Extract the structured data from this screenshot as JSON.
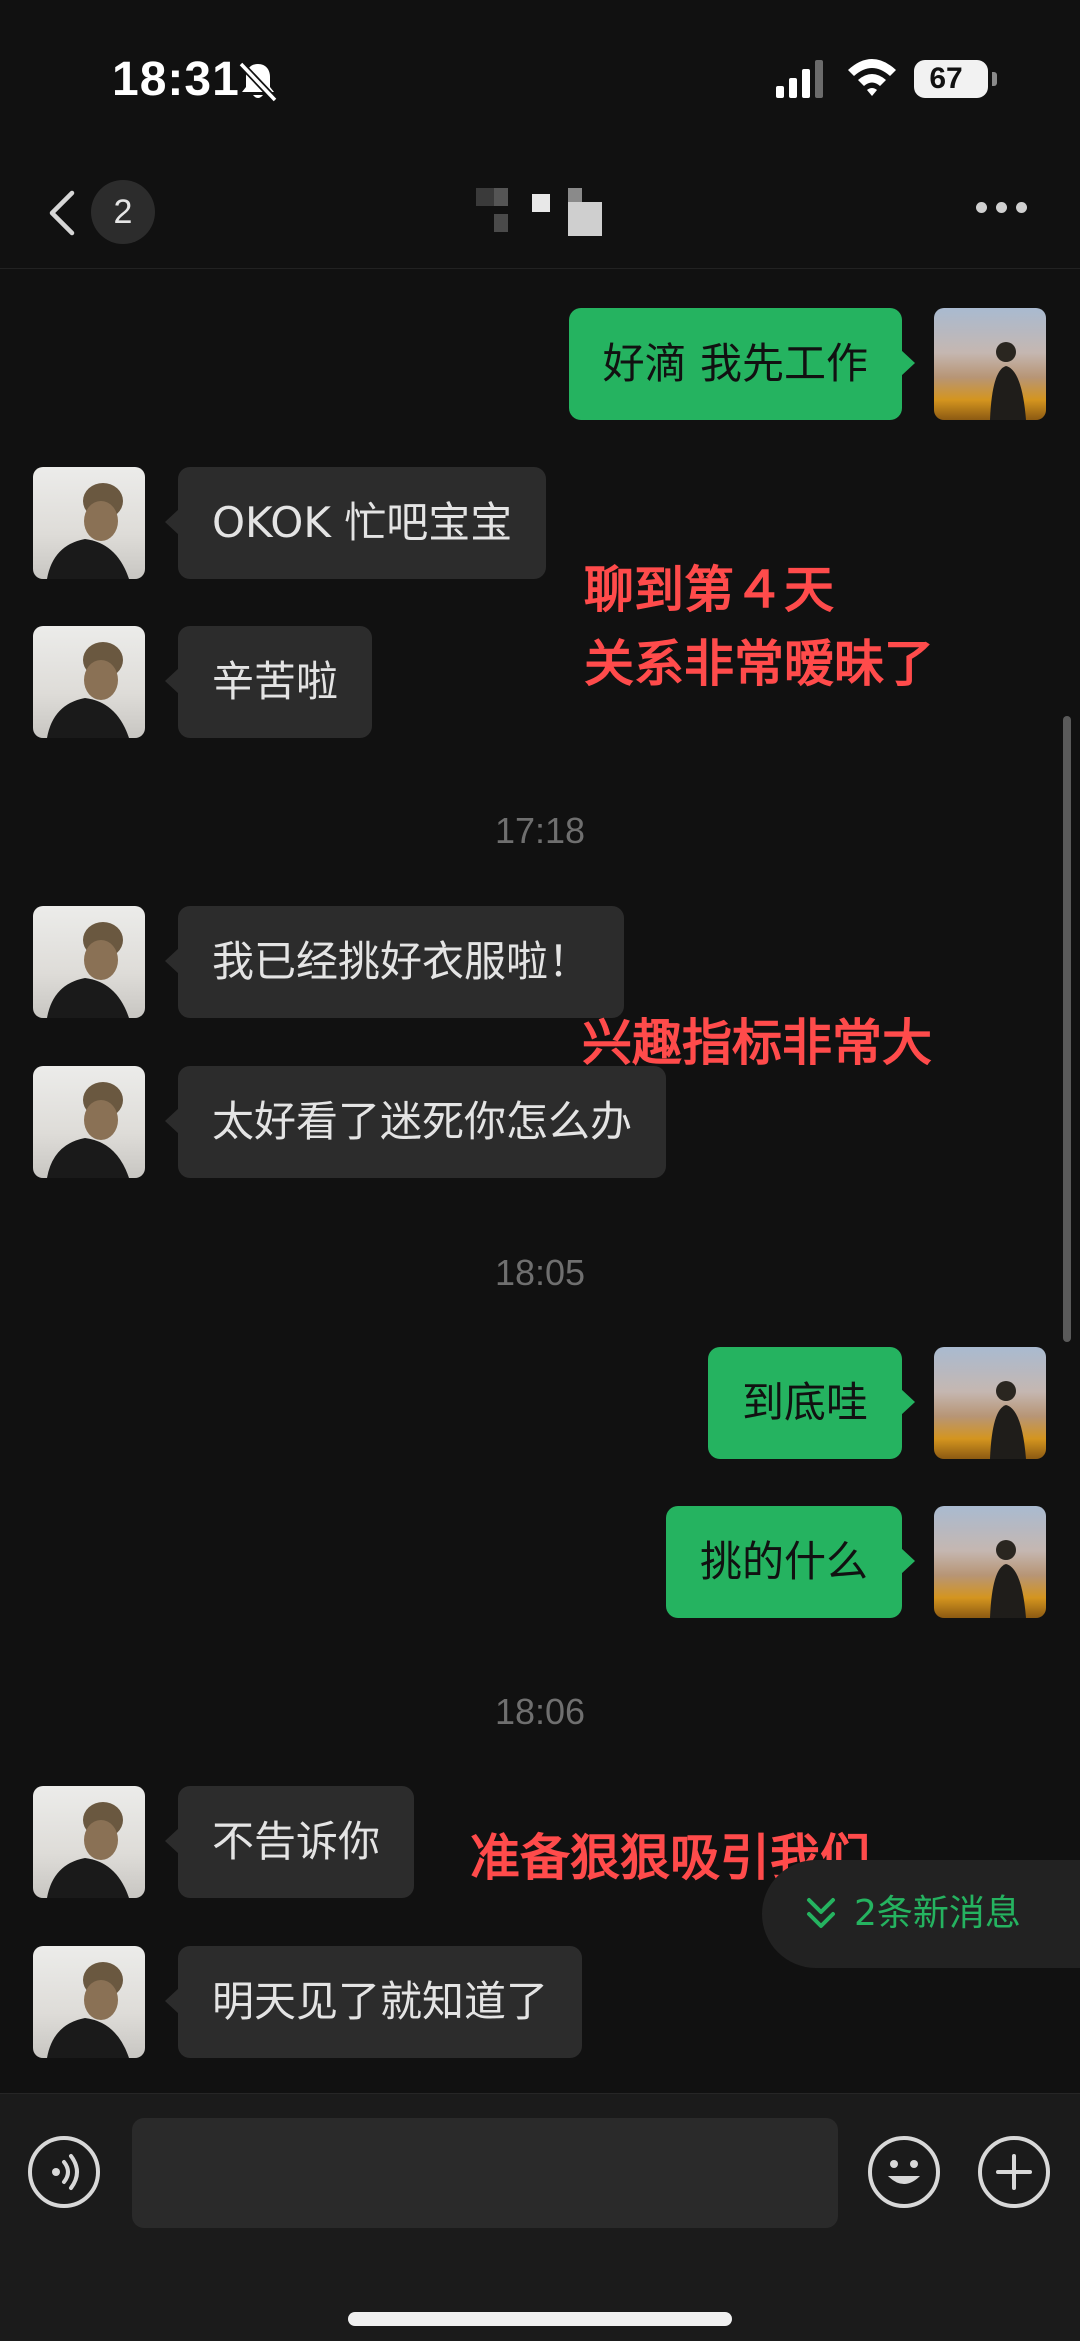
{
  "status_bar": {
    "time": "18:31",
    "battery": "67",
    "icons": [
      "bell-muted-icon",
      "signal-icon",
      "wifi-icon",
      "battery-icon"
    ]
  },
  "header": {
    "back_icon": "chevron-left-icon",
    "unread_count": "2",
    "title_note": "pixelated-contact-name",
    "more_icon": "ellipsis-icon"
  },
  "messages": [
    {
      "side": "out",
      "text": "好滴 我先工作"
    },
    {
      "side": "in",
      "text": "OKOK 忙吧宝宝"
    },
    {
      "side": "in",
      "text": "辛苦啦"
    },
    {
      "timestamp": "17:18"
    },
    {
      "side": "in",
      "text": "我已经挑好衣服啦！"
    },
    {
      "side": "in",
      "text": "太好看了迷死你怎么办"
    },
    {
      "timestamp": "18:05"
    },
    {
      "side": "out",
      "text": "到底哇"
    },
    {
      "side": "out",
      "text": "挑的什么"
    },
    {
      "timestamp": "18:06"
    },
    {
      "side": "in",
      "text": "不告诉你"
    },
    {
      "side": "in",
      "text": "明天见了就知道了"
    }
  ],
  "annotations": {
    "a1_line1": "聊到第４天",
    "a1_line2": "关系非常暧昧了",
    "a2": "兴趣指标非常大",
    "a3": "准备狠狠吸引我们"
  },
  "new_messages": {
    "icon": "double-chevron-down-icon",
    "text": "2条新消息"
  },
  "input_bar": {
    "voice_icon": "voice-icon",
    "input_value": "",
    "emoji_icon": "emoji-icon",
    "plus_icon": "plus-icon"
  },
  "colors": {
    "background": "#111111",
    "incoming_bubble": "#2c2c2c",
    "outgoing_bubble": "#25b360",
    "annotation": "#ff4b4b",
    "new_message_text": "#25b360"
  }
}
